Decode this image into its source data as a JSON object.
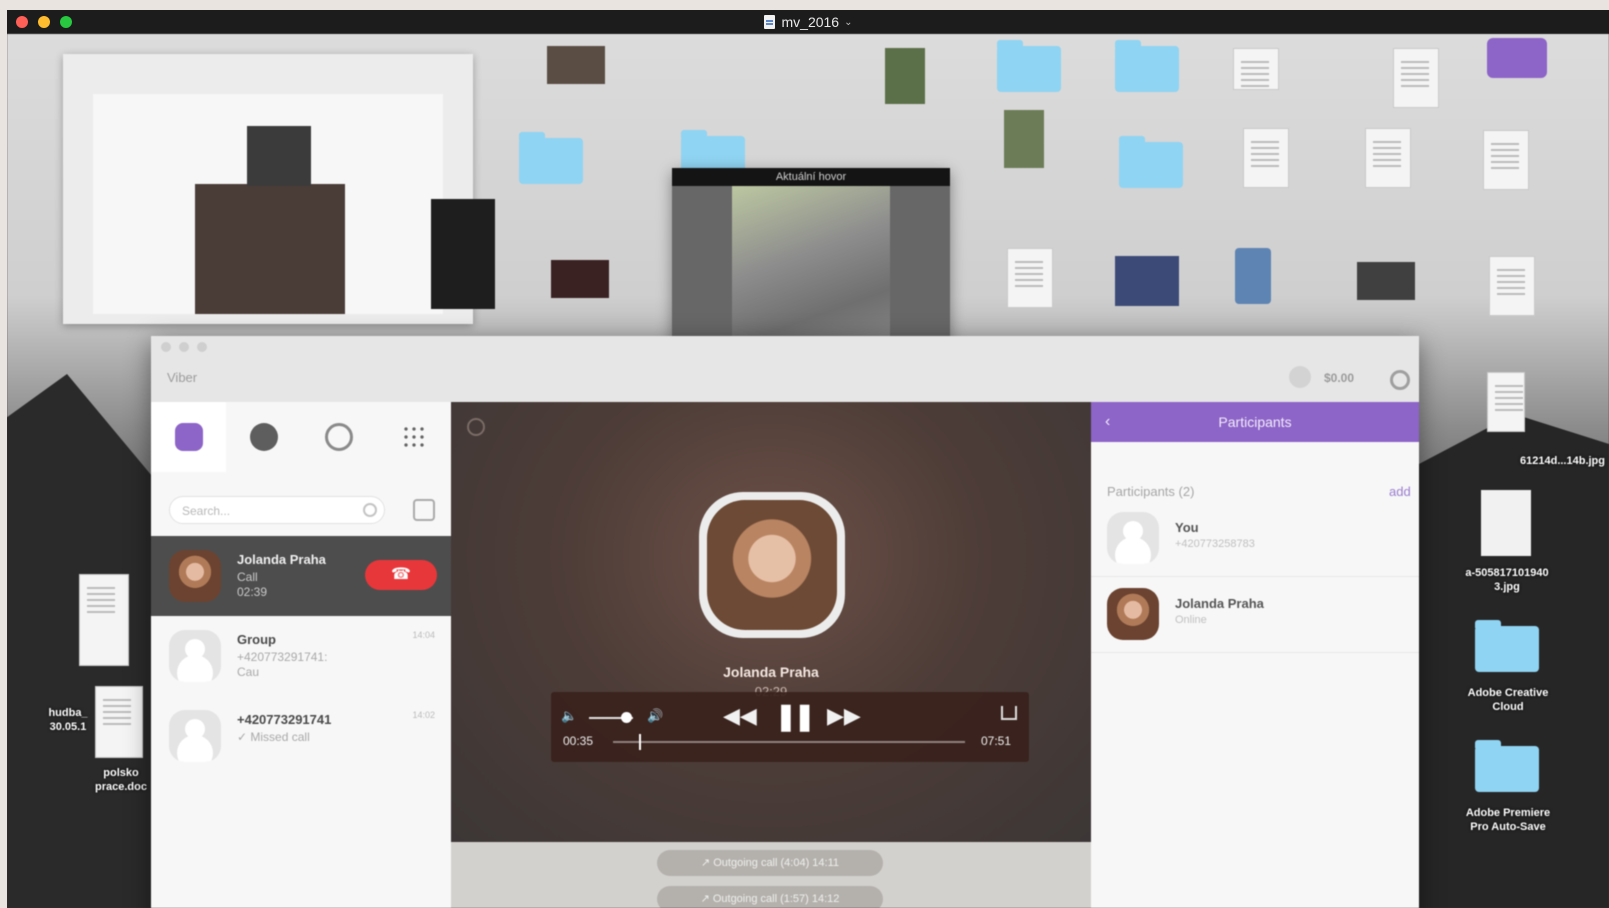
{
  "player": {
    "title": "mv_2016",
    "colors": {
      "close": "#fe5f57",
      "minimize": "#febc2e",
      "zoom": "#28c840"
    }
  },
  "desktop": {
    "labels": {
      "hudba": "hudba_\n30.05.1",
      "polsko": "polsko\nprace.doc",
      "photo_name": "a-505817101940\n3.jpg",
      "photo_name_top": "61214d...14b.jpg",
      "adobe_cc": "Adobe Creative\nCloud",
      "adobe_pr": "Adobe Premiere\nPro Auto-Save"
    }
  },
  "preview": {
    "title": "Aktuální hovor"
  },
  "viber": {
    "app_name": "Viber",
    "balance": "$0.00",
    "search_placeholder": "Search...",
    "chats": [
      {
        "name": "Jolanda Praha",
        "line1": "Call",
        "line2": "02:39",
        "time": ""
      },
      {
        "name": "Group",
        "line1": "+420773291741:",
        "line2": "Cau",
        "time": "14:04"
      },
      {
        "name": "+420773291741",
        "line1": "✓ Missed call",
        "line2": "",
        "time": "14:02"
      }
    ],
    "end_button_icon": "☎",
    "call": {
      "name": "Jolanda Praha",
      "duration": "02:29",
      "history": [
        "↗ Outgoing call (4:04)  14:11",
        "↗ Outgoing call (1:57)  14:12"
      ]
    },
    "participants": {
      "header": "Participants",
      "count_label": "Participants (2)",
      "add_label": "add",
      "list": [
        {
          "name": "You",
          "sub": "+420773258783"
        },
        {
          "name": "Jolanda Praha",
          "sub": "Online"
        }
      ]
    }
  },
  "controls": {
    "current_time": "00:35",
    "duration": "07:51",
    "volume_level": 0.85,
    "progress": 0.074,
    "icons": {
      "vol_low": "🔈",
      "vol_high": "🔊",
      "rewind": "◀◀",
      "pause": "❚❚",
      "forward": "▶▶"
    }
  },
  "callbar": {
    "icons": {
      "video": "■",
      "mic": "●",
      "end": "☎",
      "screen": "▣",
      "expand": "⤢"
    }
  },
  "accent": {
    "viber_purple": "#8d64c8",
    "end_red": "#e8373a"
  }
}
